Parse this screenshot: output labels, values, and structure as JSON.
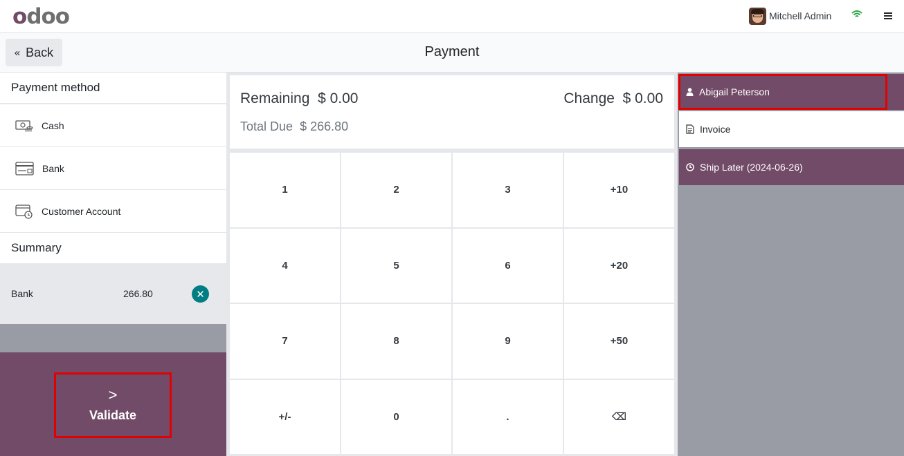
{
  "app": {
    "logo": "odoo",
    "user_name": "Mitchell Admin",
    "accent_color": "#714b67",
    "wifi_icon": "wifi-icon",
    "menu_icon": "hamburger-menu-icon"
  },
  "header": {
    "back_label": "Back",
    "title": "Payment"
  },
  "payment_methods": {
    "title": "Payment method",
    "items": [
      {
        "label": "Cash",
        "icon": "cash-icon"
      },
      {
        "label": "Bank",
        "icon": "bank-card-icon"
      },
      {
        "label": "Customer Account",
        "icon": "customer-account-icon"
      }
    ]
  },
  "summary": {
    "title": "Summary",
    "lines": [
      {
        "method": "Bank",
        "amount": "266.80",
        "remove_icon": "remove-circle-icon"
      }
    ]
  },
  "validate": {
    "label": "Validate",
    "arrow": ">"
  },
  "totals": {
    "remaining_label": "Remaining",
    "remaining_value": "$ 0.00",
    "change_label": "Change",
    "change_value": "$ 0.00",
    "total_due_label": "Total Due",
    "total_due_value": "$ 266.80"
  },
  "numpad": {
    "keys": [
      "1",
      "2",
      "3",
      "+10",
      "4",
      "5",
      "6",
      "+20",
      "7",
      "8",
      "9",
      "+50",
      "+/-",
      "0",
      ".",
      "⌫"
    ]
  },
  "right_panel": {
    "customer": "Abigail Peterson",
    "invoice": "Invoice",
    "ship_later": "Ship Later (2024-06-26)"
  }
}
